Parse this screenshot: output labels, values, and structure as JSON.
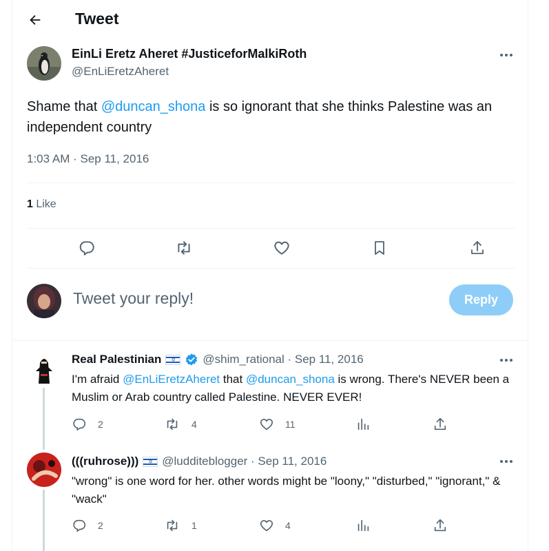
{
  "header": {
    "title": "Tweet",
    "back_icon": "arrow-left-icon"
  },
  "tweet": {
    "author_name": "EinLi Eretz Aheret #JusticeforMalkiRoth",
    "author_handle": "@EnLiEretzAheret",
    "text_before": "Shame that ",
    "mention": "@duncan_shona",
    "text_after": " is so ignorant that she thinks Palestine was an independent country",
    "timestamp": "1:03 AM · Sep 11, 2016",
    "likes_count": "1",
    "likes_label": " Like"
  },
  "composer": {
    "placeholder": "Tweet your reply!",
    "reply_label": "Reply"
  },
  "replies": [
    {
      "name": "Real Palestinian",
      "handle_date": "@shim_rational · Sep 11, 2016",
      "t1": "I'm afraid ",
      "m1": "@EnLiEretzAheret",
      "t2": " that ",
      "m2": "@duncan_shona",
      "t3": " is wrong. There's NEVER been a Muslim or Arab country called Palestine. NEVER EVER!",
      "replies": "2",
      "retweets": "4",
      "likes": "11"
    },
    {
      "name": "(((ruhrose)))",
      "handle_date": "@ludditeblogger · Sep 11, 2016",
      "text": "\"wrong\" is one word for her. other words might be \"loony,\" \"disturbed,\" \"ignorant,\" & \"wack\"",
      "replies": "2",
      "retweets": "1",
      "likes": "4"
    }
  ],
  "colors": {
    "accent": "#1d9bf0",
    "reply_button": "#8ecdf8",
    "muted": "#536471",
    "verified": "#1d9bf0"
  }
}
